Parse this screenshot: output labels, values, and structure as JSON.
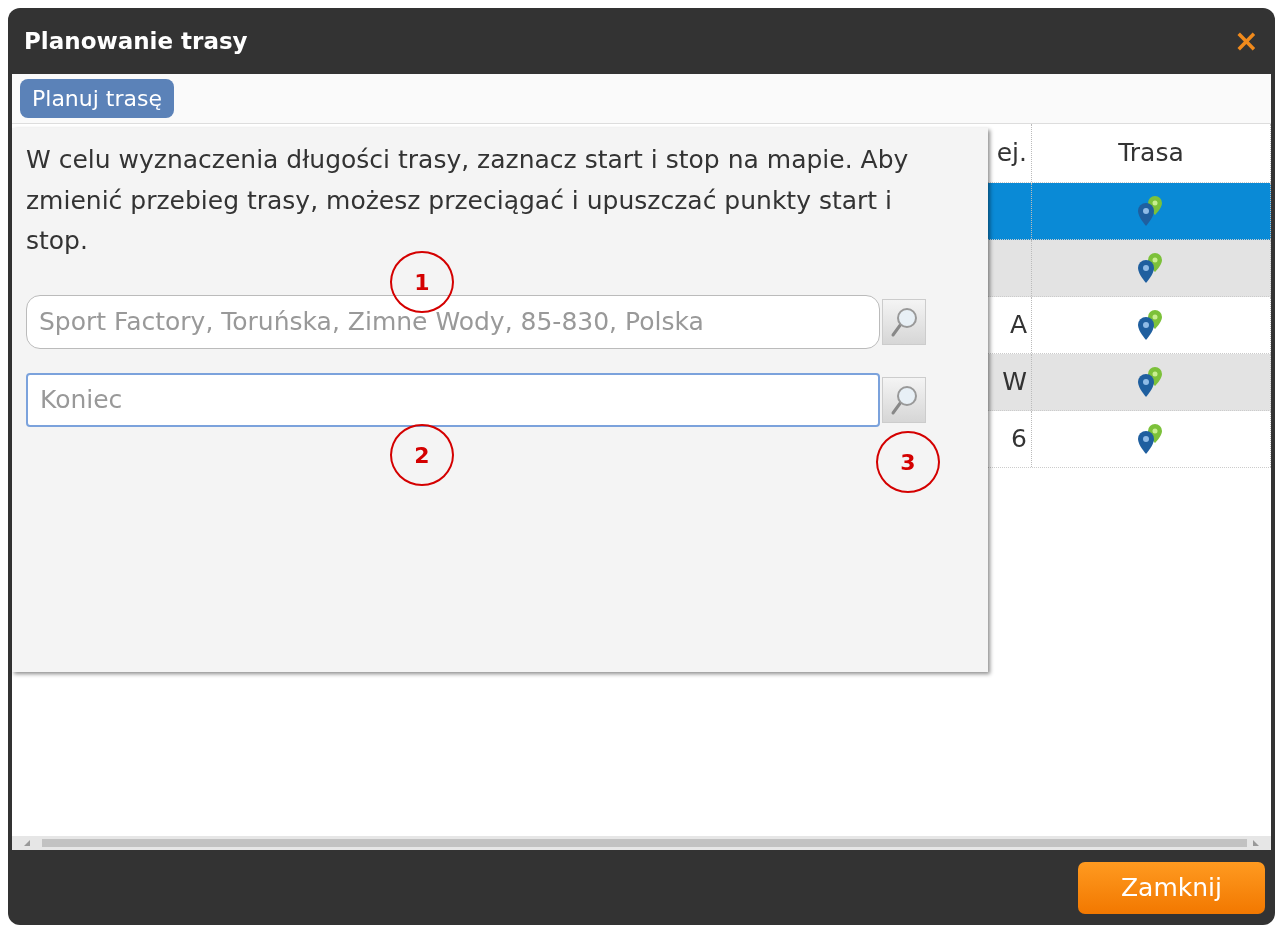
{
  "window": {
    "title": "Planowanie trasy",
    "close": "×"
  },
  "toolbar": {
    "buttons": [
      "Planuj trasę"
    ]
  },
  "table": {
    "columns": [
      {},
      {
        "label": "ej."
      },
      {
        "label": "Trasa"
      }
    ],
    "rows": [
      {
        "selected": true,
        "column_2": ""
      },
      {
        "selected": false,
        "column_2": ""
      },
      {
        "selected": false,
        "column_2": "A"
      },
      {
        "selected": false,
        "column_2": "W"
      },
      {
        "selected": false,
        "column_2": "6"
      }
    ]
  },
  "route_panel": {
    "instructions": "W celu wyznaczenia długości trasy, zaznacz start i stop na mapie. Aby zmienić przebieg trasy, możesz przeciągać i upuszczać punkty start i stop.",
    "fields": [
      {
        "value": "Sport Factory, Toruńska, Zimne Wody, 85-830, Polska",
        "focused": false
      },
      {
        "placeholder": "Koniec",
        "focused": true
      }
    ]
  },
  "annotations": [
    "1",
    "2",
    "3"
  ],
  "footer": {
    "buttons": [
      "Zamknij"
    ]
  }
}
